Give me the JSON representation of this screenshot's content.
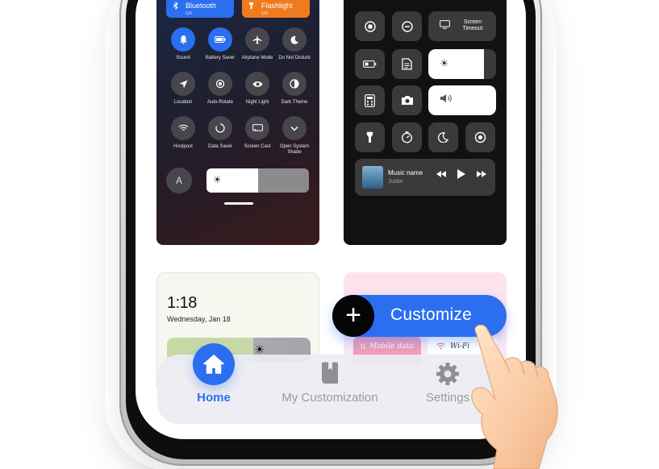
{
  "card_colorful": {
    "tile_bluetooth": {
      "label": "Bluetooth",
      "status": "On"
    },
    "tile_flashlight": {
      "label": "Flashlight",
      "status": "On"
    },
    "toggles": [
      {
        "label": "Sound",
        "icon": "bell-icon",
        "on": true
      },
      {
        "label": "Battery Saver",
        "icon": "battery-icon",
        "on": true
      },
      {
        "label": "Airplane Mode",
        "icon": "airplane-icon",
        "on": false
      },
      {
        "label": "Do Not Disturb",
        "icon": "moon-icon",
        "on": false
      },
      {
        "label": "Location",
        "icon": "location-arrow-icon",
        "on": false
      },
      {
        "label": "Auto-Rotate",
        "icon": "auto-rotate-icon",
        "on": false
      },
      {
        "label": "Night Light",
        "icon": "eye-icon",
        "on": false
      },
      {
        "label": "Dark Theme",
        "icon": "dark-theme-icon",
        "on": false
      },
      {
        "label": "Hostpost",
        "icon": "wifi-icon",
        "on": false
      },
      {
        "label": "Data Saver",
        "icon": "data-saver-icon",
        "on": false
      },
      {
        "label": "Screen Cast",
        "icon": "cast-icon",
        "on": false
      },
      {
        "label": "Open System Shade",
        "icon": "chevron-down-icon",
        "on": false
      }
    ],
    "font_button": "A",
    "brightness_level": 0.5
  },
  "card_dark": {
    "screen_timeout_label": "Screen Timeout",
    "brightness_level": 0.82,
    "volume_level": 1.0,
    "music": {
      "title": "Music name",
      "artist": "Justin"
    }
  },
  "card_clock": {
    "time": "1:18",
    "date": "Wednesday, Jan 18"
  },
  "card_pink": {
    "mobile_data_label": "Mobile data",
    "wifi_label": "Wi-Fi"
  },
  "customize_label": "Customize",
  "tabbar": {
    "tabs": [
      {
        "label": "Home",
        "active": true
      },
      {
        "label": "My Customization",
        "active": false
      },
      {
        "label": "Settings",
        "active": false
      }
    ]
  },
  "colors": {
    "accent": "#2b6ef0",
    "orange": "#f07b1f",
    "inactive": "#9a9a9f"
  }
}
